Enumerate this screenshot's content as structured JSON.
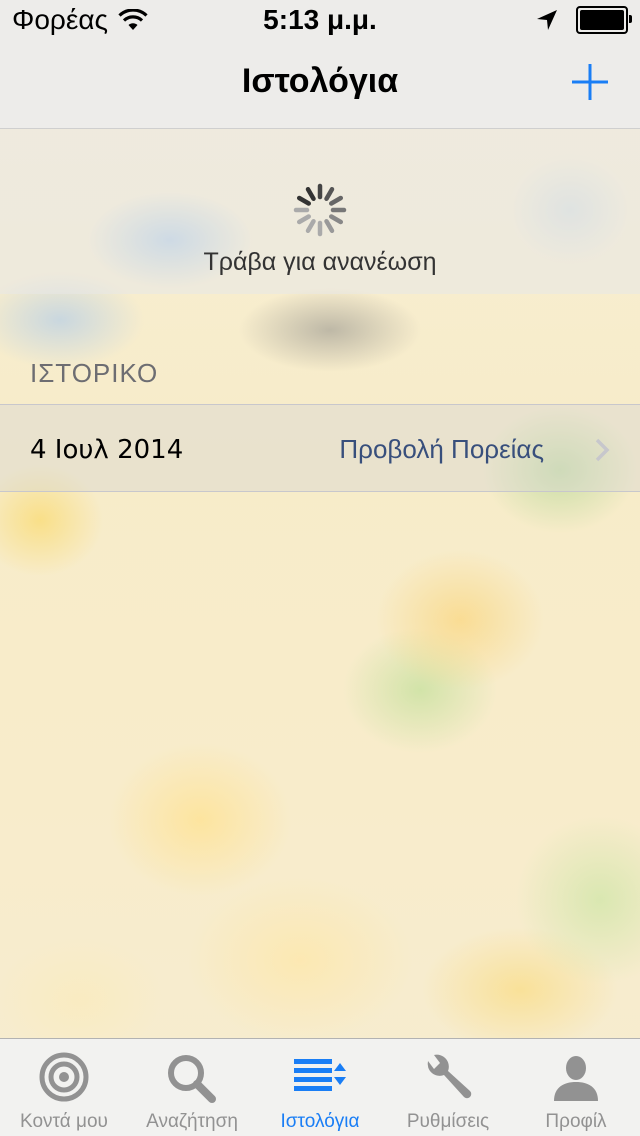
{
  "status_bar": {
    "carrier": "Φορέας",
    "time": "5:13 μ.μ.",
    "battery_level": 1.0
  },
  "nav": {
    "title": "Ιστολόγια",
    "add_icon": "plus-icon",
    "accent_color": "#1a7ef5"
  },
  "refresh": {
    "label": "Τράβα για ανανέωση"
  },
  "history": {
    "section_title": "ΙΣΤΟΡΙΚΟ",
    "rows": [
      {
        "date": "4 Ιουλ 2014",
        "detail": "Προβολή Πορείας"
      }
    ]
  },
  "tabs": [
    {
      "label": "Κοντά μου",
      "icon": "target-icon",
      "active": false
    },
    {
      "label": "Αναζήτηση",
      "icon": "search-icon",
      "active": false
    },
    {
      "label": "Ιστολόγια",
      "icon": "list-sort-icon",
      "active": true
    },
    {
      "label": "Ρυθμίσεις",
      "icon": "wrench-icon",
      "active": false
    },
    {
      "label": "Προφίλ",
      "icon": "person-icon",
      "active": false
    }
  ]
}
